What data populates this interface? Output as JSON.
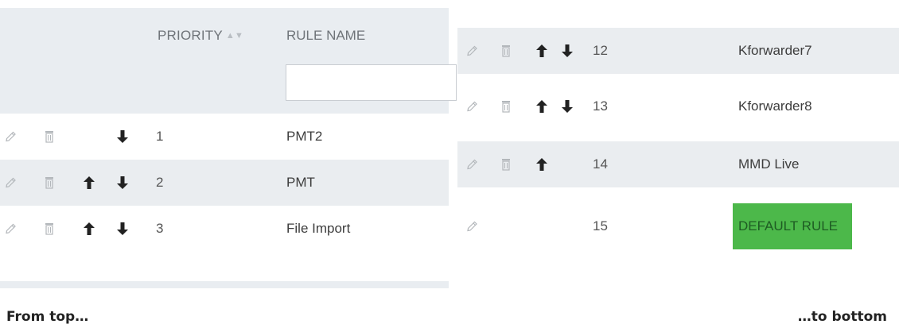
{
  "left": {
    "header": {
      "priority_label": "PRIORITY",
      "sort_icon": "sort-icon",
      "rule_name_label": "RULE NAME",
      "filter_value": ""
    },
    "rows": [
      {
        "priority": "1",
        "name": "PMT2",
        "edit": true,
        "delete": true,
        "up": false,
        "down": true
      },
      {
        "priority": "2",
        "name": "PMT",
        "edit": true,
        "delete": true,
        "up": true,
        "down": true
      },
      {
        "priority": "3",
        "name": "File Import",
        "edit": true,
        "delete": true,
        "up": true,
        "down": true
      }
    ]
  },
  "right": {
    "rows": [
      {
        "priority": "12",
        "name": "Kforwarder7",
        "edit": true,
        "delete": true,
        "up": true,
        "down": true
      },
      {
        "priority": "13",
        "name": "Kforwarder8",
        "edit": true,
        "delete": true,
        "up": true,
        "down": true
      },
      {
        "priority": "14",
        "name": "MMD Live",
        "edit": true,
        "delete": true,
        "up": true,
        "down": false
      },
      {
        "priority": "15",
        "name": "DEFAULT RULE",
        "edit": true,
        "delete": false,
        "up": false,
        "down": false
      }
    ]
  },
  "captions": {
    "left": "From top…",
    "right": "…to bottom"
  },
  "colors": {
    "header_bg": "#e9edf1",
    "row_alt_bg": "#eaedf0",
    "default_rule_bg": "#4cb84a",
    "default_rule_text": "#1e5c23"
  }
}
